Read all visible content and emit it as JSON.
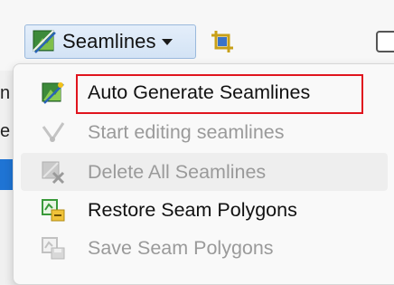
{
  "toolbar": {
    "seamlines_button_label": "Seamlines",
    "seamlines_button_icon": "seamlines-icon",
    "crop_icon": "clip-extent-icon",
    "checkbox_checked": false
  },
  "left_panel": {
    "fragments": [
      "n",
      "e"
    ]
  },
  "menu": {
    "items": [
      {
        "label": "Auto Generate Seamlines",
        "enabled": true,
        "icon": "auto-generate-icon"
      },
      {
        "label": "Start editing seamlines",
        "enabled": false,
        "icon": "edit-seamlines-icon"
      },
      {
        "label": "Delete All Seamlines",
        "enabled": false,
        "icon": "delete-seamlines-icon"
      },
      {
        "label": "Restore Seam Polygons",
        "enabled": true,
        "icon": "restore-polygons-icon"
      },
      {
        "label": "Save Seam Polygons",
        "enabled": false,
        "icon": "save-polygons-icon"
      }
    ]
  },
  "colors": {
    "highlight": "#e0141e",
    "button_border": "#9ab9dc",
    "selection": "#1f74d4",
    "disabled_text": "#9a9a9a"
  }
}
